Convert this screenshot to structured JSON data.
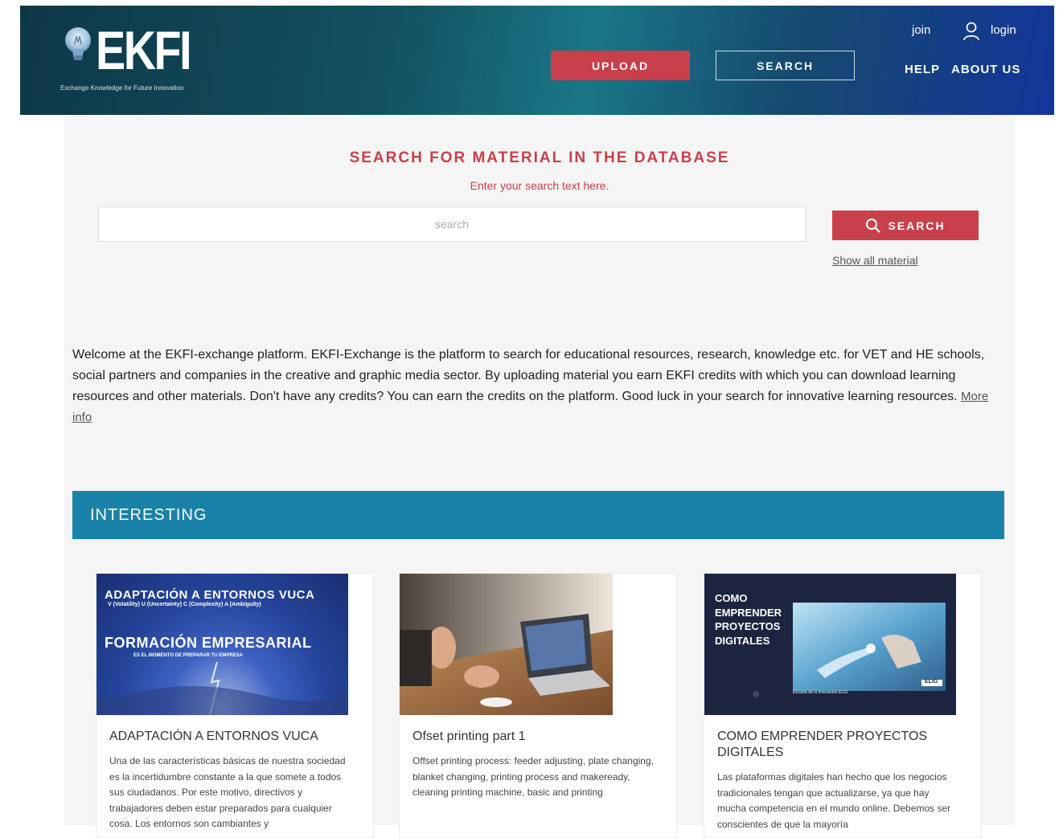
{
  "header": {
    "logo_text": "EKFI",
    "logo_tagline": "Exchange Knowledge for Future Innovation",
    "upload_label": "UPLOAD",
    "search_label": "SEARCH",
    "join_label": "join",
    "login_label": "login",
    "help_label": "HELP",
    "about_label": "ABOUT US"
  },
  "search": {
    "title": "SEARCH FOR MATERIAL IN THE DATABASE",
    "subtitle": "Enter your search text here.",
    "placeholder": "search",
    "button_label": "SEARCH",
    "show_all_label": "Show all material"
  },
  "welcome": {
    "text": "Welcome at the EKFI-exchange platform. EKFI-Exchange is the platform to search for educational resources, research, knowledge etc. for VET and HE schools, social partners and companies in the creative and graphic media sector. By uploading material you earn EKFI credits with which you can download learning resources and other materials. Don't have any credits? You can earn the credits on the platform. Good luck in your search for innovative learning resources.",
    "more_info_label": "More info"
  },
  "interesting": {
    "heading": "INTERESTING",
    "cards": [
      {
        "image_title": "ADAPTACIÓN A ENTORNOS VUCA",
        "image_subtitle": "V (Volatility) U (Uncertainty) C (Complexity) A (Ambiguity)",
        "image_heading": "FORMACIÓN EMPRESARIAL",
        "image_tagline": "ES EL MOMENTO DE PREPARAR TU EMPRESA",
        "title": "ADAPTACIÓN A ENTORNOS VUCA",
        "description": "Una de las características básicas de nuestra sociedad es la incertidumbre constante a la que somete a todos sus ciudadanos. Por este motivo, directivos y trabajadores deben estar preparados para cualquier cosa. Los entornos son cambiantes y"
      },
      {
        "title": "Ofset printing part 1",
        "description": "Offset printing process: feeder adjusting, plate changing, blanket changing, printing process and makeready, cleaning printing machine, basic and printing"
      },
      {
        "image_title": "COMO EMPRENDER PROYECTOS DIGITALES",
        "image_badge": "ELIG",
        "image_caption": "Escuela de la Innovación ELIG",
        "title": "COMO EMPRENDER PROYECTOS DIGITALES",
        "description": "Las plataformas digitales han hecho que los negocios tradicionales tengan que actualizarse, ya que hay mucha competencia en el mundo online. Debemos ser conscientes de que la mayoría"
      }
    ]
  },
  "colors": {
    "accent_red": "#c8404c",
    "banner_blue": "#1a82a8",
    "header_dark": "#0d3848"
  }
}
